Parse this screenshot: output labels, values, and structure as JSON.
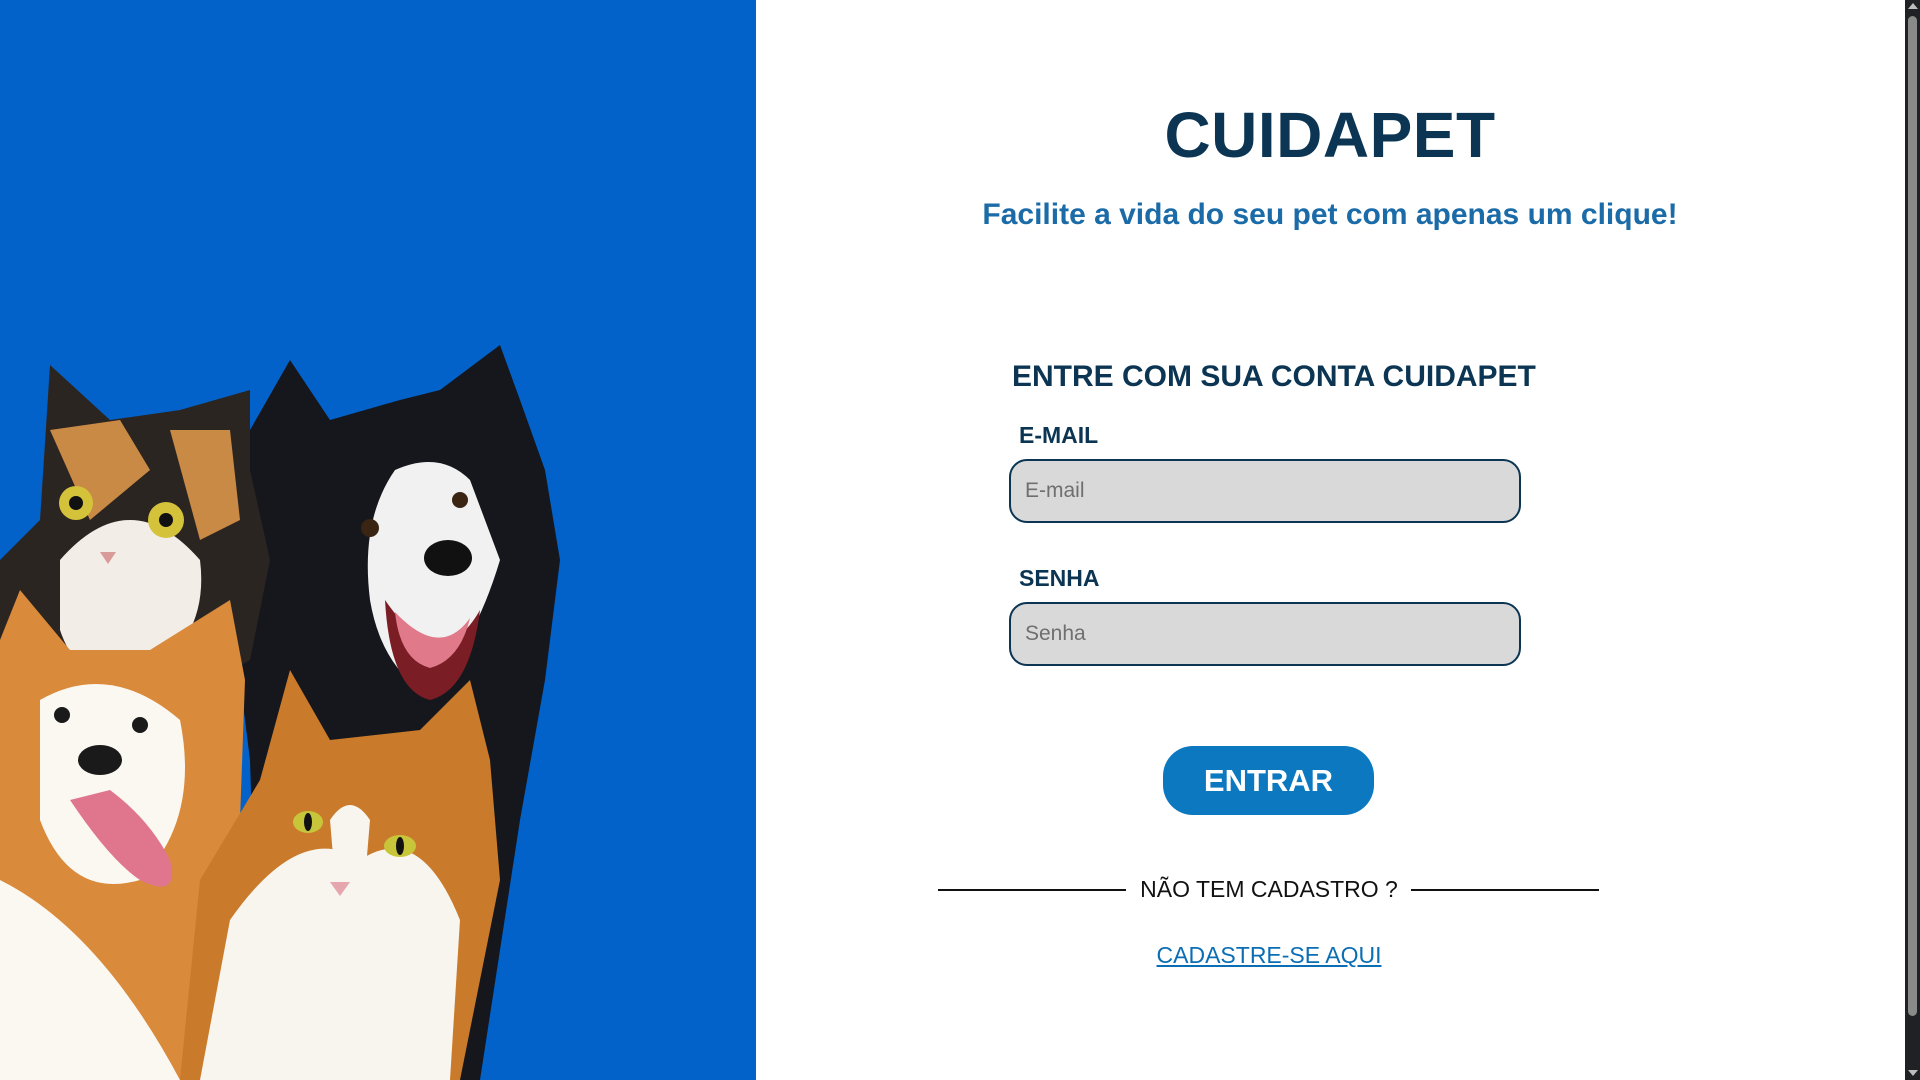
{
  "hero": {
    "background_color": "#0262C9",
    "image_subject": "pets-group-photo",
    "animals": [
      "calico-cat",
      "border-collie-dog",
      "corgi-dog",
      "orange-white-cat"
    ]
  },
  "header": {
    "brand": "CUIDAPET",
    "tagline": "Facilite a vida do seu pet com apenas um clique!"
  },
  "login_form": {
    "title": "ENTRE COM SUA CONTA CUIDAPET",
    "email": {
      "label": "E-MAIL",
      "placeholder": "E-mail",
      "value": ""
    },
    "password": {
      "label": "SENHA",
      "placeholder": "Senha",
      "value": ""
    },
    "submit_label": "ENTRAR"
  },
  "signup": {
    "prompt": "NÃO TEM CADASTRO ?",
    "link_label": "CADASTRE-SE AQUI"
  },
  "colors": {
    "brand_dark": "#0B3553",
    "brand_blue": "#1A6BA7",
    "button_blue": "#0B78C0",
    "input_bg": "#D9D9D9"
  }
}
